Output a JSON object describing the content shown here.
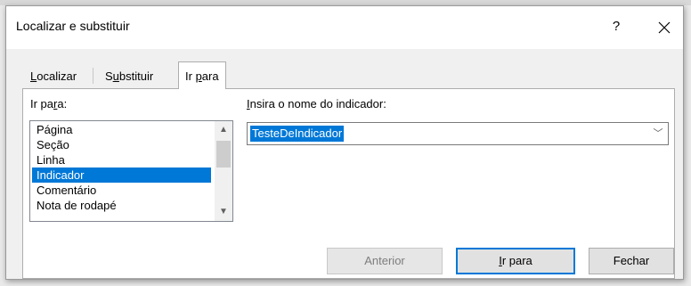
{
  "dialog": {
    "title": "Localizar e substituir",
    "help_icon": "?",
    "close_icon": "close-icon"
  },
  "tabs": [
    {
      "pre": "",
      "mnemonic": "L",
      "post": "ocalizar",
      "active": false
    },
    {
      "pre": "S",
      "mnemonic": "u",
      "post": "bstituir",
      "active": false
    },
    {
      "pre": "Ir ",
      "mnemonic": "p",
      "post": "ara",
      "active": true
    }
  ],
  "go_to_list": {
    "label_pre": "Ir pa",
    "label_mnemonic": "r",
    "label_post": "a:",
    "items": [
      "Página",
      "Seção",
      "Linha",
      "Indicador",
      "Comentário",
      "Nota de rodapé"
    ],
    "selected": "Indicador"
  },
  "bookmark": {
    "label_pre": "",
    "label_mnemonic": "I",
    "label_post": "nsira o nome do indicador:",
    "value": "TesteDeIndicador"
  },
  "buttons": {
    "previous": "Anterior",
    "go_pre": "",
    "go_mnemonic": "I",
    "go_post": "r para",
    "close": "Fechar"
  },
  "colors": {
    "accent": "#0078d7",
    "dialog_bg": "#f0f0f0",
    "panel_bg": "#ffffff"
  }
}
